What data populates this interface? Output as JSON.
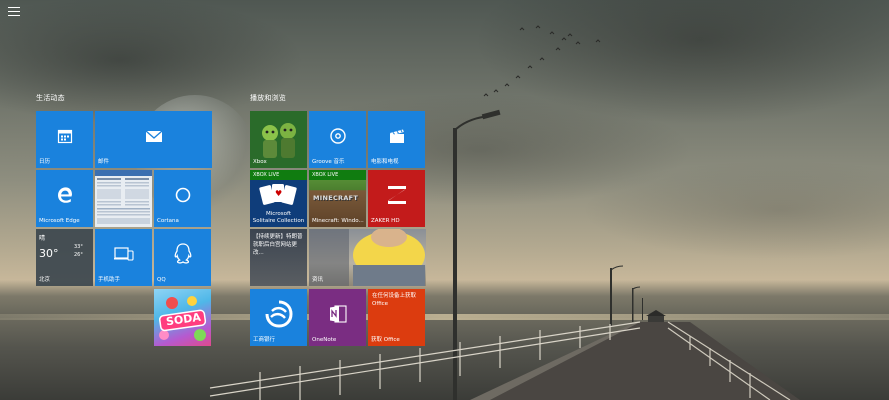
{
  "start_menu": {
    "hamburger_icon": "hamburger-menu-icon"
  },
  "groups": {
    "life": {
      "title": "生活动态",
      "tiles": {
        "calendar": {
          "label": "日历",
          "icon": "calendar-icon"
        },
        "mail": {
          "label": "邮件",
          "icon": "mail-icon"
        },
        "edge": {
          "label": "Microsoft Edge",
          "icon": "edge-icon"
        },
        "cortana": {
          "label": "Cortana",
          "icon": "cortana-circle-icon"
        },
        "weather": {
          "city": "晴",
          "temp": "30°",
          "high": "33°",
          "low": "26°",
          "location": "北京"
        },
        "phone": {
          "label": "手机助手",
          "icon": "phone-assistant-icon"
        },
        "qq": {
          "label": "QQ",
          "icon": "qq-penguin-icon"
        },
        "candy": {
          "text": "SODA",
          "icon": "candy-crush-soda-icon"
        }
      }
    },
    "play": {
      "title": "播放和浏览",
      "tiles": {
        "xbox": {
          "label": "Xbox",
          "icon": "xbox-avatars-icon"
        },
        "groove": {
          "label": "Groove 音乐",
          "icon": "groove-disc-icon"
        },
        "movies": {
          "label": "电影和电视",
          "icon": "movie-clapper-icon"
        },
        "solitaire": {
          "badge": "XBOX LIVE",
          "label": "Microsoft\nSolitaire Collection",
          "icon": "playing-cards-icon"
        },
        "minecraft": {
          "badge": "XBOX LIVE",
          "label": "Minecraft: Windo...",
          "logo": "MINECRAFT"
        },
        "zaker": {
          "label": "ZAKER HD",
          "icon": "zaker-logo-icon"
        },
        "news": {
          "text": "【持续更新】特朗普就职后白宫网站更改..."
        },
        "news_photo": {
          "label": "资讯"
        },
        "icbc": {
          "label": "工商银行",
          "icon": "icbc-logo-icon"
        },
        "onenote": {
          "label": "OneNote",
          "icon": "onenote-icon"
        },
        "office": {
          "text": "在任何设备上获取 Office",
          "label": "获取 Office",
          "icon": "office-icon"
        }
      }
    }
  },
  "colors": {
    "tile_blue": "#1a82dd",
    "tile_green": "#107c10",
    "tile_red": "#c31b1b",
    "tile_orange": "#dc3c0f",
    "tile_purple": "#7a2d82"
  }
}
